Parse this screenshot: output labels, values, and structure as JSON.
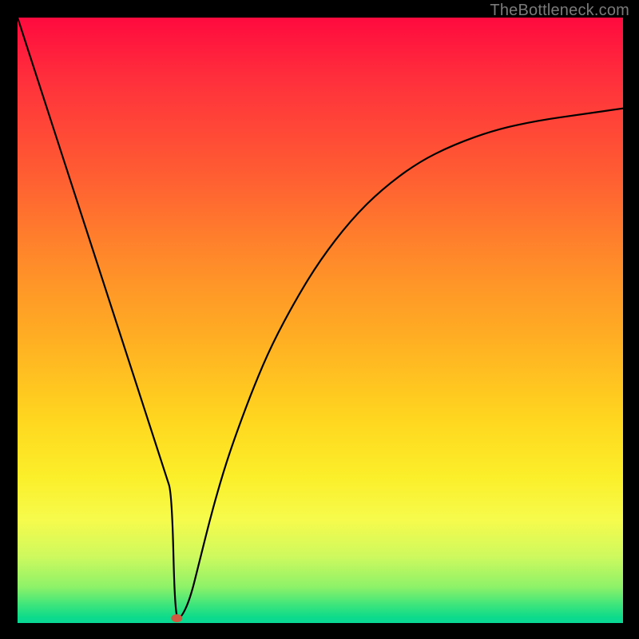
{
  "watermark": "TheBottleneck.com",
  "chart_data": {
    "type": "line",
    "title": "",
    "xlabel": "",
    "ylabel": "",
    "xlim": [
      0,
      100
    ],
    "ylim": [
      0,
      100
    ],
    "grid": false,
    "legend": false,
    "series": [
      {
        "name": "bottleneck-curve",
        "x": [
          0,
          3.5,
          7,
          10.5,
          14,
          17.5,
          21,
          24.5,
          25.5,
          26,
          27,
          28.5,
          30,
          32,
          34,
          36,
          39,
          42,
          46,
          50,
          55,
          60,
          66,
          72,
          79,
          86,
          93,
          100
        ],
        "values": [
          100,
          89.2,
          78.4,
          67.6,
          56.8,
          46,
          35.2,
          24.4,
          21.3,
          0.8,
          0.8,
          4,
          10,
          18,
          25,
          31,
          39,
          46,
          53.5,
          60,
          66.5,
          71.5,
          76,
          79,
          81.5,
          83,
          84,
          85
        ]
      }
    ],
    "markers": [
      {
        "name": "min-point",
        "x": 26.3,
        "y": 0.8,
        "color": "#d05a3f",
        "r": 1.1
      }
    ],
    "colors": {
      "curve": "#000000",
      "marker": "#d05a3f",
      "bg_top": "#ff0a3e",
      "bg_bottom": "#08d797"
    }
  }
}
